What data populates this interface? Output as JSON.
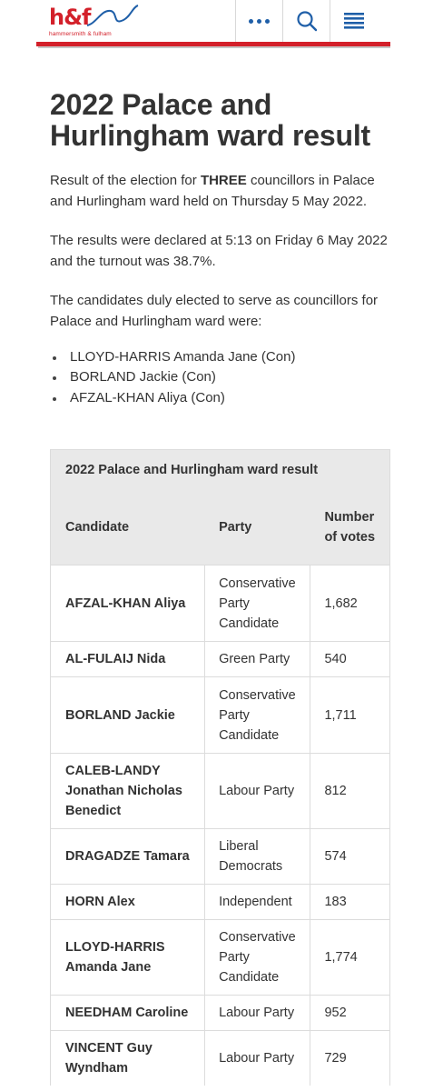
{
  "header": {
    "logo_text": "h&f",
    "logo_subtitle": "hammersmith & fulham",
    "more_icon": "more-dots-icon",
    "search_icon": "search-icon",
    "menu_icon": "menu-icon",
    "brand_color": "#d3202a",
    "icon_color": "#1f5fa8"
  },
  "page": {
    "title": "2022 Palace and Hurlingham ward result",
    "intro_before": "Result of the election for ",
    "intro_bold": "THREE",
    "intro_after": " councillors in Palace and Hurlingham ward held on Thursday 5 May 2022.",
    "declared": "The results were declared at 5:13 on Friday 6 May 2022 and the turnout was 38.7%.",
    "elected_intro": "The candidates duly elected to serve as councillors for Palace and Hurlingham ward were:",
    "elected": [
      "LLOYD-HARRIS Amanda Jane (Con)",
      "BORLAND Jackie (Con)",
      "AFZAL-KHAN Aliya (Con)"
    ]
  },
  "table": {
    "caption": "2022 Palace and Hurlingham ward result",
    "headers": [
      "Candidate",
      "Party",
      "Number of votes"
    ],
    "rows": [
      {
        "candidate": "AFZAL-KHAN Aliya",
        "party": "Conservative Party Candidate",
        "votes": "1,682"
      },
      {
        "candidate": "AL-FULAIJ Nida",
        "party": "Green Party",
        "votes": "540"
      },
      {
        "candidate": "BORLAND Jackie",
        "party": "Conservative Party Candidate",
        "votes": "1,711"
      },
      {
        "candidate": "CALEB-LANDY Jonathan Nicholas Benedict",
        "party": "Labour Party",
        "votes": "812"
      },
      {
        "candidate": "DRAGADZE Tamara",
        "party": "Liberal Democrats",
        "votes": "574"
      },
      {
        "candidate": "HORN Alex",
        "party": "Independent",
        "votes": "183"
      },
      {
        "candidate": "LLOYD-HARRIS Amanda Jane",
        "party": "Conservative Party Candidate",
        "votes": "1,774"
      },
      {
        "candidate": "NEEDHAM Caroline",
        "party": "Labour Party",
        "votes": "952"
      },
      {
        "candidate": "VINCENT Guy Wyndham",
        "party": "Labour Party",
        "votes": "729"
      }
    ]
  }
}
